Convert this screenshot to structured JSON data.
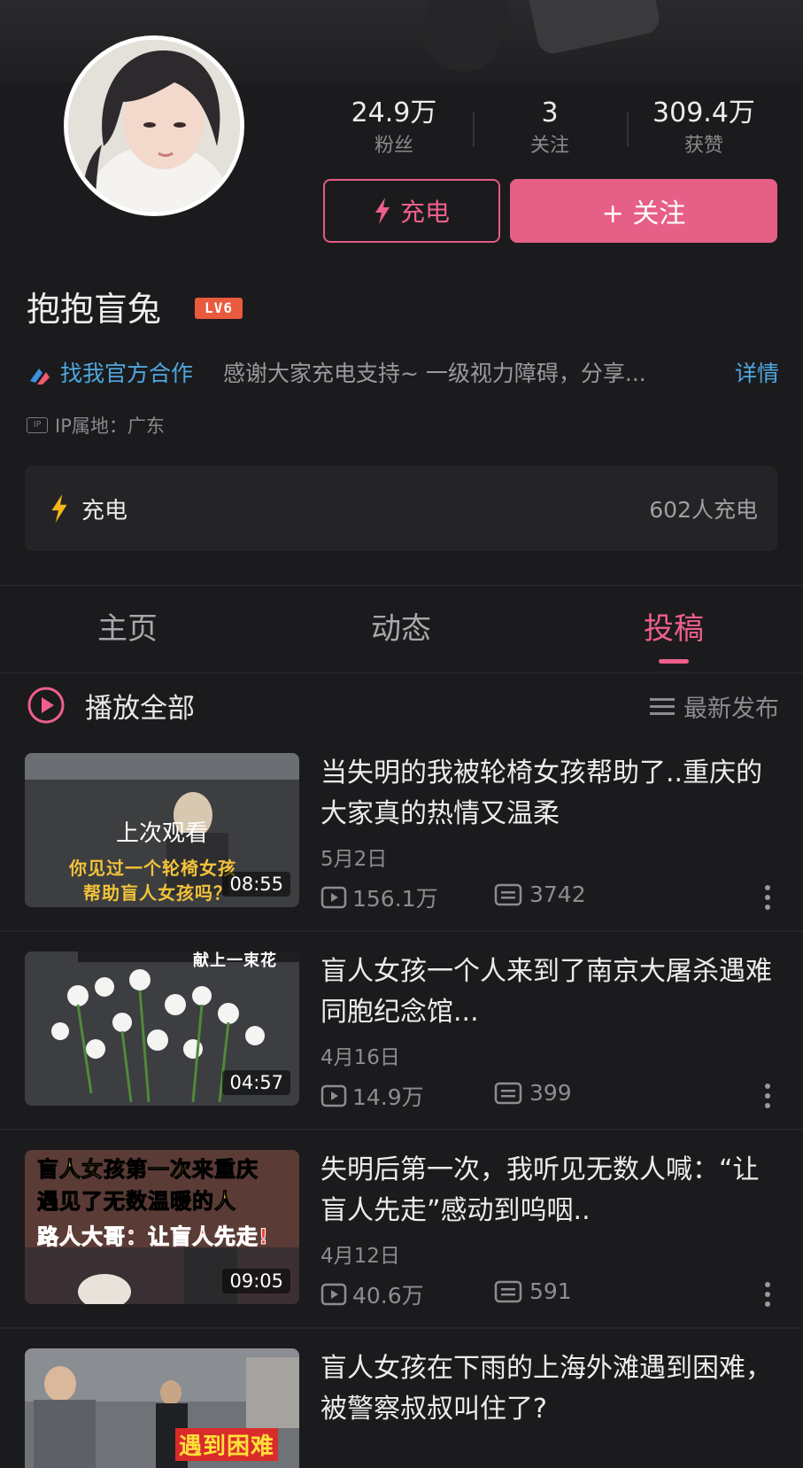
{
  "profile": {
    "stats": [
      {
        "value": "24.9万",
        "label": "粉丝"
      },
      {
        "value": "3",
        "label": "关注"
      },
      {
        "value": "309.4万",
        "label": "获赞"
      }
    ],
    "charge_button": "充电",
    "follow_button": "+ 关注",
    "username": "抱抱盲兔",
    "level_badge": "LV6",
    "coop_link": "找我官方合作",
    "intro": "感谢大家充电支持~ 一级视力障碍，分享...",
    "more_link": "详情",
    "ip_location": "IP属地：广东",
    "ip_icon_text": "IP"
  },
  "charge_card": {
    "title": "充电",
    "count": "602人充电"
  },
  "tabs": [
    "主页",
    "动态",
    "投稿"
  ],
  "active_tab": "投稿",
  "list_header": {
    "play_all": "播放全部",
    "sort": "最新发布"
  },
  "videos": [
    {
      "title": "当失明的我被轮椅女孩帮助了..重庆的大家真的热情又温柔",
      "date": "5月2日",
      "views": "156.1万",
      "comments": "3742",
      "duration": "08:55",
      "overlay": "上次观看",
      "thumb_caption_1": "你见过一个轮椅女孩",
      "thumb_caption_2": "帮助盲人女孩吗？"
    },
    {
      "title": "盲人女孩一个人来到了南京大屠杀遇难同胞纪念馆...",
      "date": "4月16日",
      "views": "14.9万",
      "comments": "399",
      "duration": "04:57",
      "thumb_caption_1": "献上一束花"
    },
    {
      "title": "失明后第一次，我听见无数人喊：“让盲人先走”感动到呜咽..",
      "date": "4月12日",
      "views": "40.6万",
      "comments": "591",
      "duration": "09:05",
      "thumb_caption_1": "盲人女孩第一次来重庆",
      "thumb_caption_2": "遇见了无数温暖的人",
      "thumb_caption_3": "路人大哥：让盲人先走!"
    },
    {
      "title": "盲人女孩在下雨的上海外滩遇到困难，被警察叔叔叫住了?",
      "thumb_caption_1": "遇到困难"
    }
  ],
  "colors": {
    "accent": "#e65f87",
    "link": "#4ea7e0",
    "background": "#1b1b1d"
  }
}
